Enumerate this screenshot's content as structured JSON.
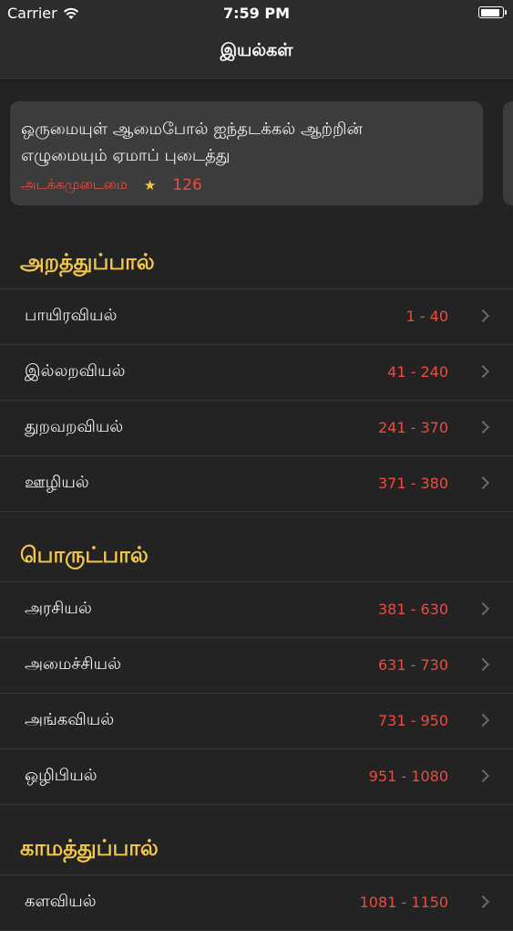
{
  "status": {
    "carrier": "Carrier",
    "time": "7:59 PM",
    "icons": [
      "wifi-icon",
      "battery-icon"
    ]
  },
  "nav": {
    "title": "இயல்கள்"
  },
  "card": {
    "line1": "ஒருமையுள் ஆமைபோல் ஐந்தடக்கல் ஆற்றின்",
    "line2": "எழுமையும் ஏமாப் புடைத்து",
    "chapter": "அடக்கமுடைமை",
    "number": "126",
    "colors": {
      "accent": "#ee4b3e",
      "star": "#f5c84a"
    }
  },
  "sections": [
    {
      "title": "அறத்துப்பால்",
      "rows": [
        {
          "name": "பாயிரவியல்",
          "range": "1 - 40"
        },
        {
          "name": "இல்லறவியல்",
          "range": "41 - 240"
        },
        {
          "name": "துறவறவியல்",
          "range": "241 - 370"
        },
        {
          "name": "ஊழியல்",
          "range": "371 - 380"
        }
      ]
    },
    {
      "title": "பொருட்பால்",
      "rows": [
        {
          "name": "அரசியல்",
          "range": "381 - 630"
        },
        {
          "name": "அமைச்சியல்",
          "range": "631 - 730"
        },
        {
          "name": "அங்கவியல்",
          "range": "731 - 950"
        },
        {
          "name": "ஒழிபியல்",
          "range": "951 - 1080"
        }
      ]
    },
    {
      "title": "காமத்துப்பால்",
      "rows": [
        {
          "name": "களவியல்",
          "range": "1081 - 1150"
        }
      ]
    }
  ]
}
